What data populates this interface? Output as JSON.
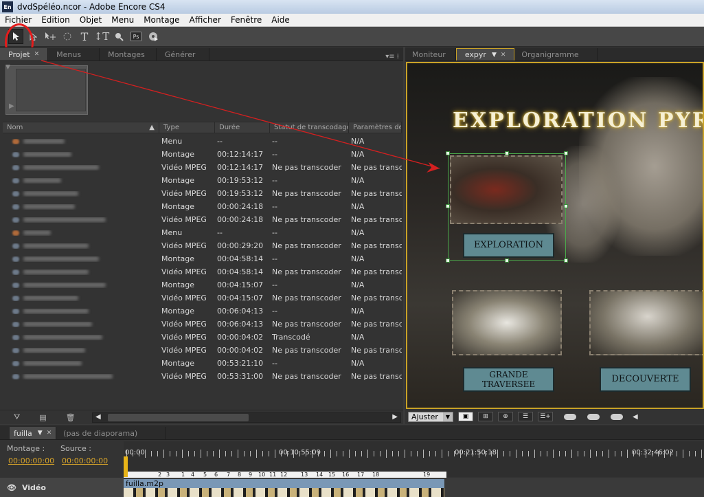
{
  "window": {
    "title": "dvdSpéléo.ncor - Adobe Encore CS4",
    "app_icon": "En"
  },
  "menu": [
    "Fichier",
    "Edition",
    "Objet",
    "Menu",
    "Montage",
    "Afficher",
    "Fenêtre",
    "Aide"
  ],
  "toolbar": {
    "tools": [
      "selection-tool",
      "direct-select-tool",
      "move-tool",
      "rotate-tool",
      "text-tool",
      "vertical-text-tool",
      "zoom-tool"
    ],
    "ps_label": "Ps"
  },
  "project_panel": {
    "tabs": [
      "Projet",
      "Menus",
      "Montages",
      "Générer"
    ],
    "columns": [
      "Nom",
      "Type",
      "Durée",
      "Statut de transcodage D...",
      "Paramètres de tra"
    ],
    "rows": [
      {
        "type": "Menu",
        "duration": "--",
        "status": "--",
        "params": "N/A"
      },
      {
        "type": "Montage",
        "duration": "00:12:14:17",
        "status": "--",
        "params": "N/A"
      },
      {
        "type": "Vidéo MPEG",
        "duration": "00:12:14:17",
        "status": "Ne pas transcoder",
        "params": "Ne pas transco"
      },
      {
        "type": "Montage",
        "duration": "00:19:53:12",
        "status": "--",
        "params": "N/A"
      },
      {
        "type": "Vidéo MPEG",
        "duration": "00:19:53:12",
        "status": "Ne pas transcoder",
        "params": "Ne pas transco"
      },
      {
        "type": "Montage",
        "duration": "00:00:24:18",
        "status": "--",
        "params": "N/A"
      },
      {
        "type": "Vidéo MPEG",
        "duration": "00:00:24:18",
        "status": "Ne pas transcoder",
        "params": "Ne pas transco"
      },
      {
        "type": "Menu",
        "duration": "--",
        "status": "--",
        "params": "N/A"
      },
      {
        "type": "Vidéo MPEG",
        "duration": "00:00:29:20",
        "status": "Ne pas transcoder",
        "params": "Ne pas transco"
      },
      {
        "type": "Montage",
        "duration": "00:04:58:14",
        "status": "--",
        "params": "N/A"
      },
      {
        "type": "Vidéo MPEG",
        "duration": "00:04:58:14",
        "status": "Ne pas transcoder",
        "params": "Ne pas transco"
      },
      {
        "type": "Montage",
        "duration": "00:04:15:07",
        "status": "--",
        "params": "N/A"
      },
      {
        "type": "Vidéo MPEG",
        "duration": "00:04:15:07",
        "status": "Ne pas transcoder",
        "params": "Ne pas transco"
      },
      {
        "type": "Montage",
        "duration": "00:06:04:13",
        "status": "--",
        "params": "N/A"
      },
      {
        "type": "Vidéo MPEG",
        "duration": "00:06:04:13",
        "status": "Ne pas transcoder",
        "params": "Ne pas transco"
      },
      {
        "type": "Vidéo MPEG",
        "duration": "00:00:04:02",
        "status": "Transcodé",
        "params": "N/A"
      },
      {
        "type": "Vidéo MPEG",
        "duration": "00:00:04:02",
        "status": "Ne pas transcoder",
        "params": "Ne pas transco"
      },
      {
        "type": "Montage",
        "duration": "00:53:21:10",
        "status": "--",
        "params": "N/A"
      },
      {
        "type": "Vidéo MPEG",
        "duration": "00:53:31:00",
        "status": "Ne pas transcoder",
        "params": "Ne pas transco"
      }
    ]
  },
  "monitor_panel": {
    "tabs": [
      "Moniteur",
      "expyr",
      "Organigramme"
    ],
    "menu_title": "EXPLORATION PYR",
    "buttons": [
      "EXPLORATION",
      "GRANDE TRAVERSEE",
      "DECOUVERTE"
    ],
    "fit_label": "Ajuster"
  },
  "timeline": {
    "tab_label": "fuilla",
    "slideshow_label": "(pas de diaporama)",
    "montage_label": "Montage :",
    "source_label": "Source :",
    "montage_tc": "00:00:00:00",
    "source_tc": "00:00:00:00",
    "ruler_labels": [
      "00:00",
      "00:10:55:09",
      "00:21:50:18",
      "00:32:46:02"
    ],
    "chapter_markers": [
      "2",
      "3",
      "1",
      "4",
      "5",
      "6",
      "7",
      "8",
      "9",
      "10",
      "11",
      "12",
      "13",
      "14",
      "15",
      "16",
      "17",
      "18",
      "19"
    ],
    "track_label": "Vidéo",
    "clip_name": "fuilla.m2p"
  },
  "colors": {
    "accent_timecode": "#d6a32a",
    "selection": "#4aa84a",
    "annotation": "#e41b1b"
  }
}
